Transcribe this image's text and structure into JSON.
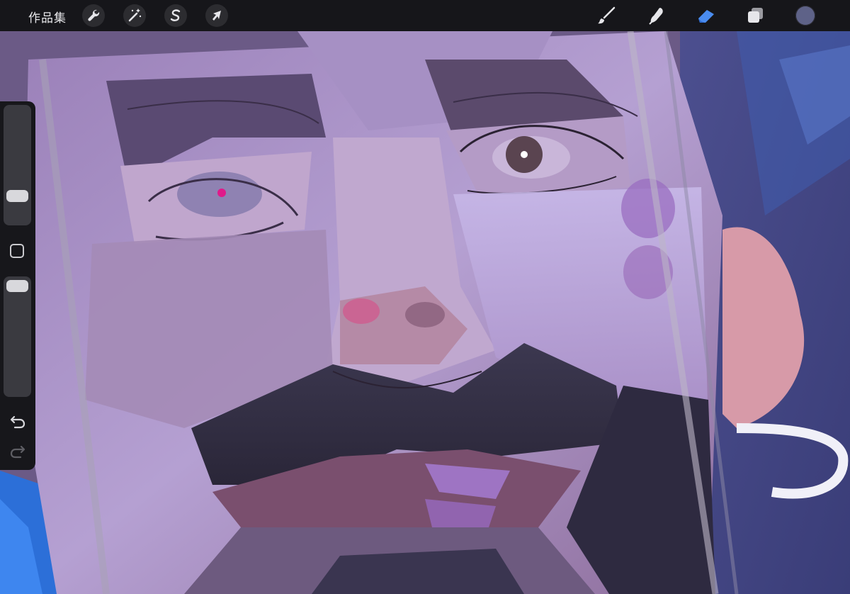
{
  "toolbar": {
    "gallery_label": "作品集",
    "left_tools": [
      {
        "name": "actions",
        "icon": "wrench-icon"
      },
      {
        "name": "adjustments",
        "icon": "magic-wand-icon"
      },
      {
        "name": "selection",
        "icon": "selection-s-icon"
      },
      {
        "name": "transform",
        "icon": "arrow-cursor-icon"
      }
    ],
    "right_tools": [
      {
        "name": "brush",
        "icon": "paintbrush-icon",
        "active": false
      },
      {
        "name": "smudge",
        "icon": "smudge-finger-icon",
        "active": false
      },
      {
        "name": "eraser",
        "icon": "eraser-icon",
        "active": true
      },
      {
        "name": "layers",
        "icon": "layers-icon",
        "active": false
      },
      {
        "name": "color",
        "icon": "color-swatch",
        "active": false
      }
    ],
    "active_color": "#4a8cf0",
    "current_color": "#5e6288"
  },
  "sidebar": {
    "brush_size": 0.2,
    "brush_opacity": 0.94,
    "icons": [
      "square-modify-icon",
      "undo-icon",
      "redo-icon"
    ]
  },
  "canvas": {
    "subject": "painting-face-closeup"
  }
}
